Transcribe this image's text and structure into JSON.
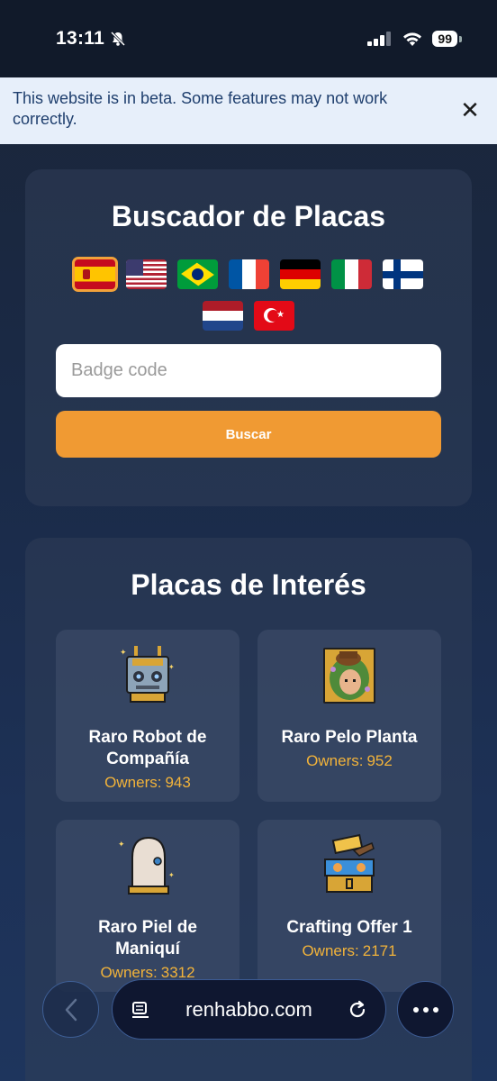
{
  "status_bar": {
    "time": "13:11",
    "battery": "99",
    "icons": [
      "bell-slash-icon",
      "signal-icon",
      "wifi-icon",
      "battery-icon"
    ]
  },
  "beta_banner": {
    "text": "This website is in beta. Some features may not work correctly.",
    "close_icon": "✕"
  },
  "search": {
    "title": "Buscador de Placas",
    "flags": [
      "es",
      "us",
      "br",
      "fr",
      "de",
      "it",
      "fi",
      "nl",
      "tr"
    ],
    "selected_flag": "es",
    "input_placeholder": "Badge code",
    "input_value": "",
    "button_label": "Buscar",
    "accent_color": "#f09a33"
  },
  "interest": {
    "title": "Placas de Interés",
    "owners_label": "Owners:",
    "badges": [
      {
        "name": "Raro Robot de Compañía",
        "owners": "943",
        "icon": "robot-badge"
      },
      {
        "name": "Raro Pelo Planta",
        "owners": "952",
        "icon": "plant-hair-badge"
      },
      {
        "name": "Raro Piel de Maniquí",
        "owners": "3312",
        "icon": "mannequin-badge"
      },
      {
        "name": "Crafting Offer 1",
        "owners": "2171",
        "icon": "crafting-chest-badge"
      }
    ]
  },
  "browser": {
    "url": "renhabbo.com"
  }
}
